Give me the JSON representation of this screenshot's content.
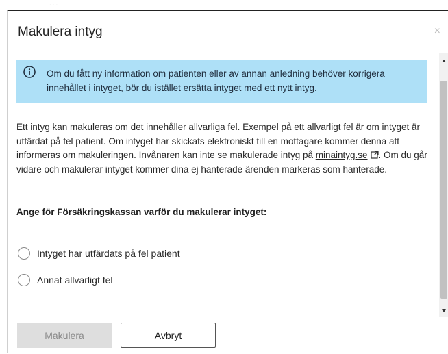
{
  "background": {
    "faint_text": "..."
  },
  "dialog": {
    "title": "Makulera intyg",
    "close_symbol": "×",
    "info": {
      "icon": "info-icon",
      "text": "Om du fått ny information om patienten eller av annan anledning behöver korrigera innehållet i intyget, bör du istället ersätta intyget med ett nytt intyg."
    },
    "body": {
      "text_before_link": "Ett intyg kan makuleras om det innehåller allvarliga fel. Exempel på ett allvarligt fel är om intyget är utfärdat på fel patient. Om intyget har skickats elektroniskt till en mottagare kommer denna att informeras om makuleringen. Invånaren kan inte se makulerade intyg på ",
      "link_text": "minaintyg.se",
      "link_icon": "external-link-icon",
      "text_after_link": ". Om du går vidare och makulerar intyget kommer dina ej hanterade ärenden markeras som hanterade."
    },
    "question": "Ange för Försäkringskassan varför du makulerar intyget:",
    "options": [
      {
        "label": "Intyget har utfärdats på fel patient",
        "selected": false
      },
      {
        "label": "Annat allvarligt fel",
        "selected": false
      }
    ],
    "buttons": {
      "primary_label": "Makulera",
      "primary_enabled": false,
      "secondary_label": "Avbryt"
    }
  },
  "colors": {
    "info_background": "#aee0f7",
    "primary_disabled_bg": "#dedede",
    "primary_disabled_text": "#8a8a8a"
  }
}
